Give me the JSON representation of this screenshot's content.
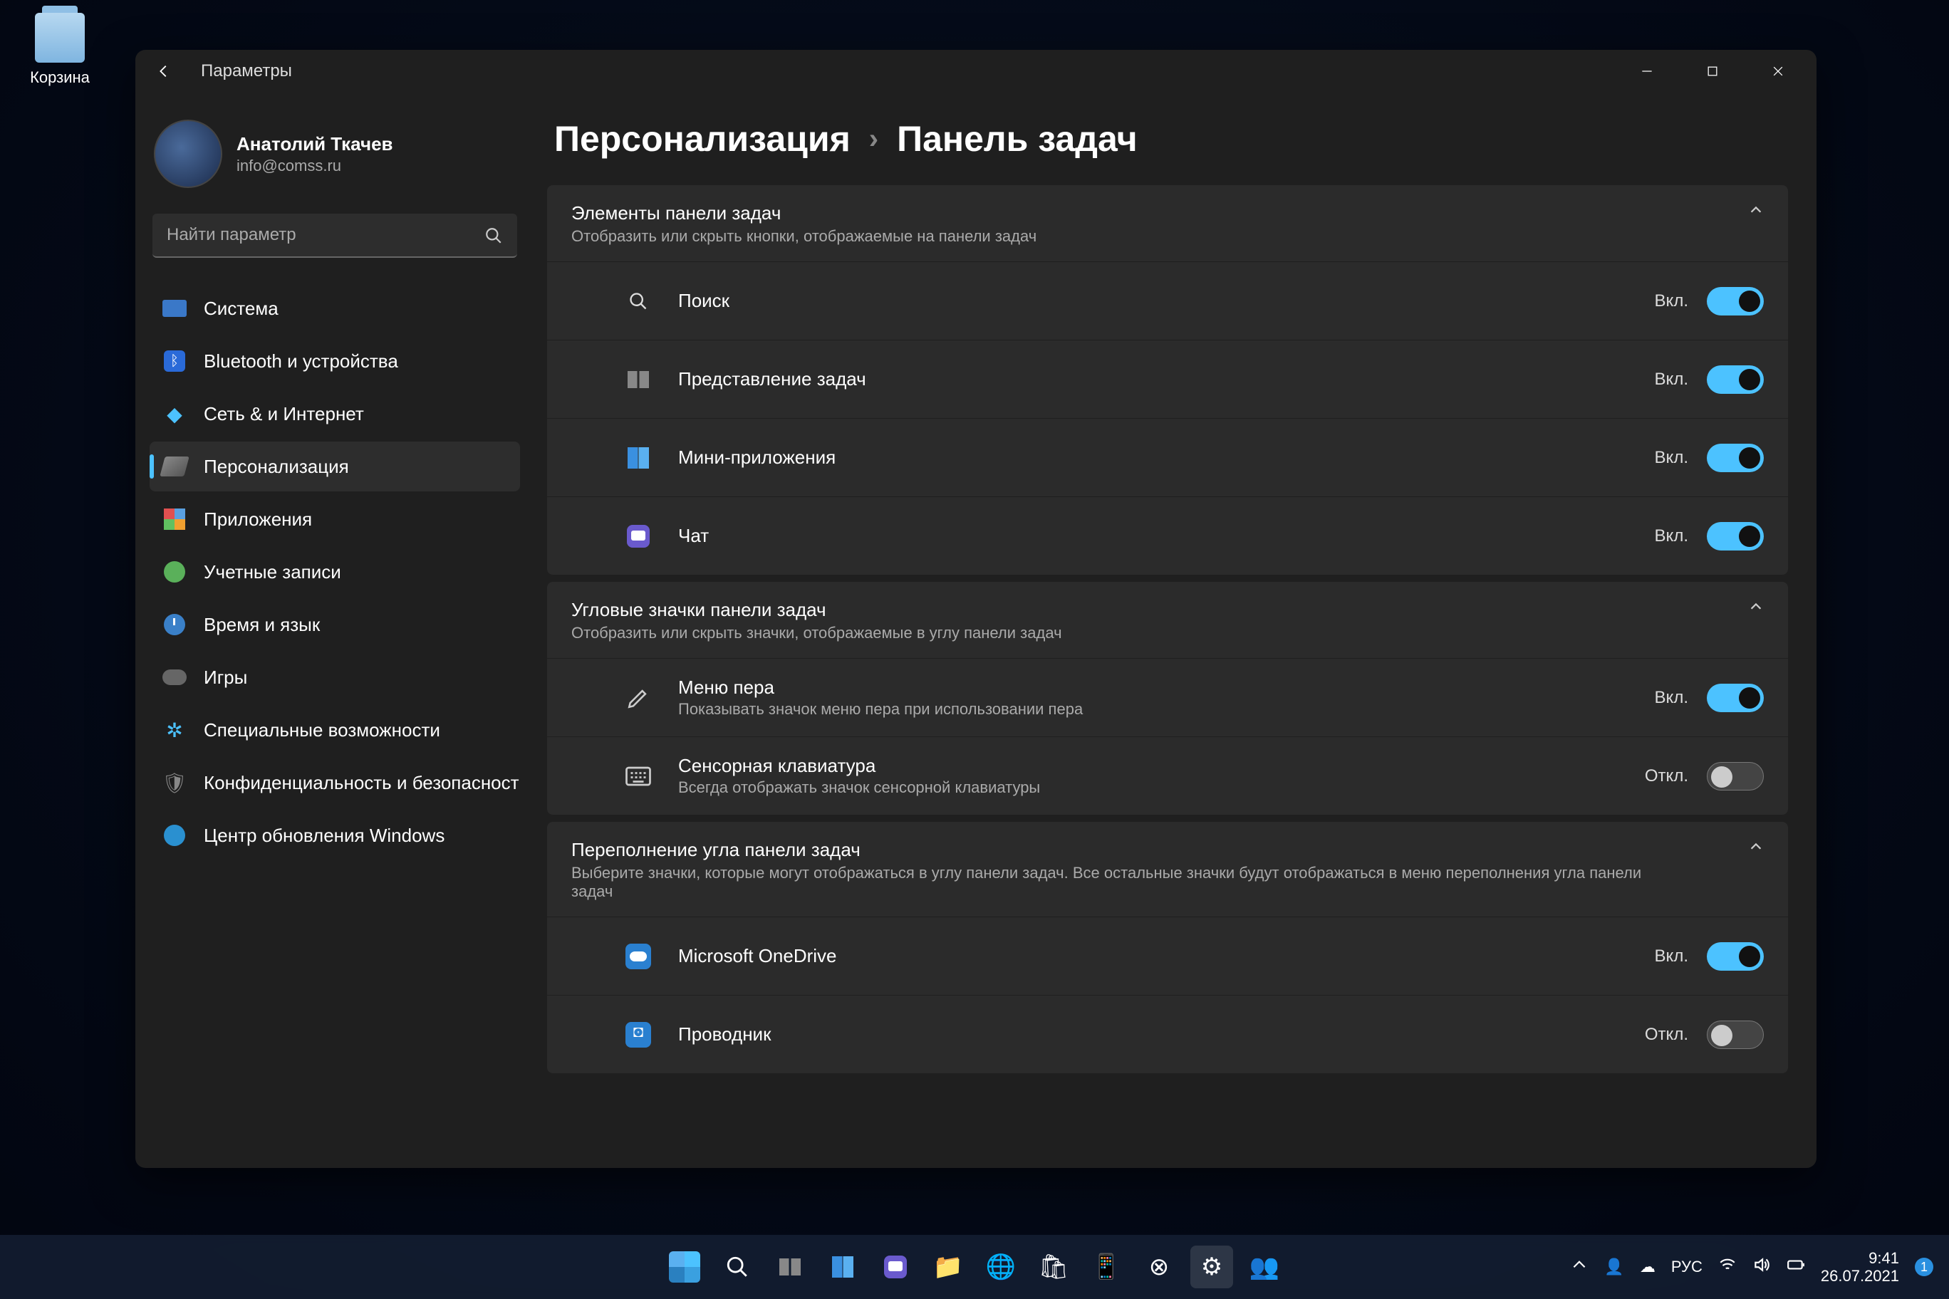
{
  "desktop": {
    "recycle_bin": "Корзина"
  },
  "window": {
    "title": "Параметры"
  },
  "user": {
    "name": "Анатолий Ткачев",
    "email": "info@comss.ru"
  },
  "search": {
    "placeholder": "Найти параметр"
  },
  "nav": [
    {
      "label": "Система"
    },
    {
      "label": "Bluetooth и устройства"
    },
    {
      "label": "Сеть & и Интернет"
    },
    {
      "label": "Персонализация"
    },
    {
      "label": "Приложения"
    },
    {
      "label": "Учетные записи"
    },
    {
      "label": "Время и язык"
    },
    {
      "label": "Игры"
    },
    {
      "label": "Специальные возможности"
    },
    {
      "label": "Конфиденциальность и безопасность"
    },
    {
      "label": "Центр обновления Windows"
    }
  ],
  "breadcrumb": {
    "parent": "Персонализация",
    "current": "Панель задач"
  },
  "section1": {
    "title": "Элементы панели задач",
    "subtitle": "Отобразить или скрыть кнопки, отображаемые на панели задач",
    "items": [
      {
        "label": "Поиск",
        "state": "Вкл.",
        "on": true
      },
      {
        "label": "Представление задач",
        "state": "Вкл.",
        "on": true
      },
      {
        "label": "Мини-приложения",
        "state": "Вкл.",
        "on": true
      },
      {
        "label": "Чат",
        "state": "Вкл.",
        "on": true
      }
    ]
  },
  "section2": {
    "title": "Угловые значки панели задач",
    "subtitle": "Отобразить или скрыть значки, отображаемые в углу панели задач",
    "items": [
      {
        "label": "Меню пера",
        "sub": "Показывать значок меню пера при использовании пера",
        "state": "Вкл.",
        "on": true
      },
      {
        "label": "Сенсорная клавиатура",
        "sub": "Всегда отображать значок сенсорной клавиатуры",
        "state": "Откл.",
        "on": false
      }
    ]
  },
  "section3": {
    "title": "Переполнение угла панели задач",
    "subtitle": "Выберите значки, которые могут отображаться в углу панели задач. Все остальные значки будут отображаться в меню переполнения угла панели задач",
    "items": [
      {
        "label": "Microsoft OneDrive",
        "state": "Вкл.",
        "on": true
      },
      {
        "label": "Проводник",
        "state": "Откл.",
        "on": false
      }
    ]
  },
  "systray": {
    "lang": "РУС",
    "time": "9:41",
    "date": "26.07.2021",
    "notif": "1"
  }
}
